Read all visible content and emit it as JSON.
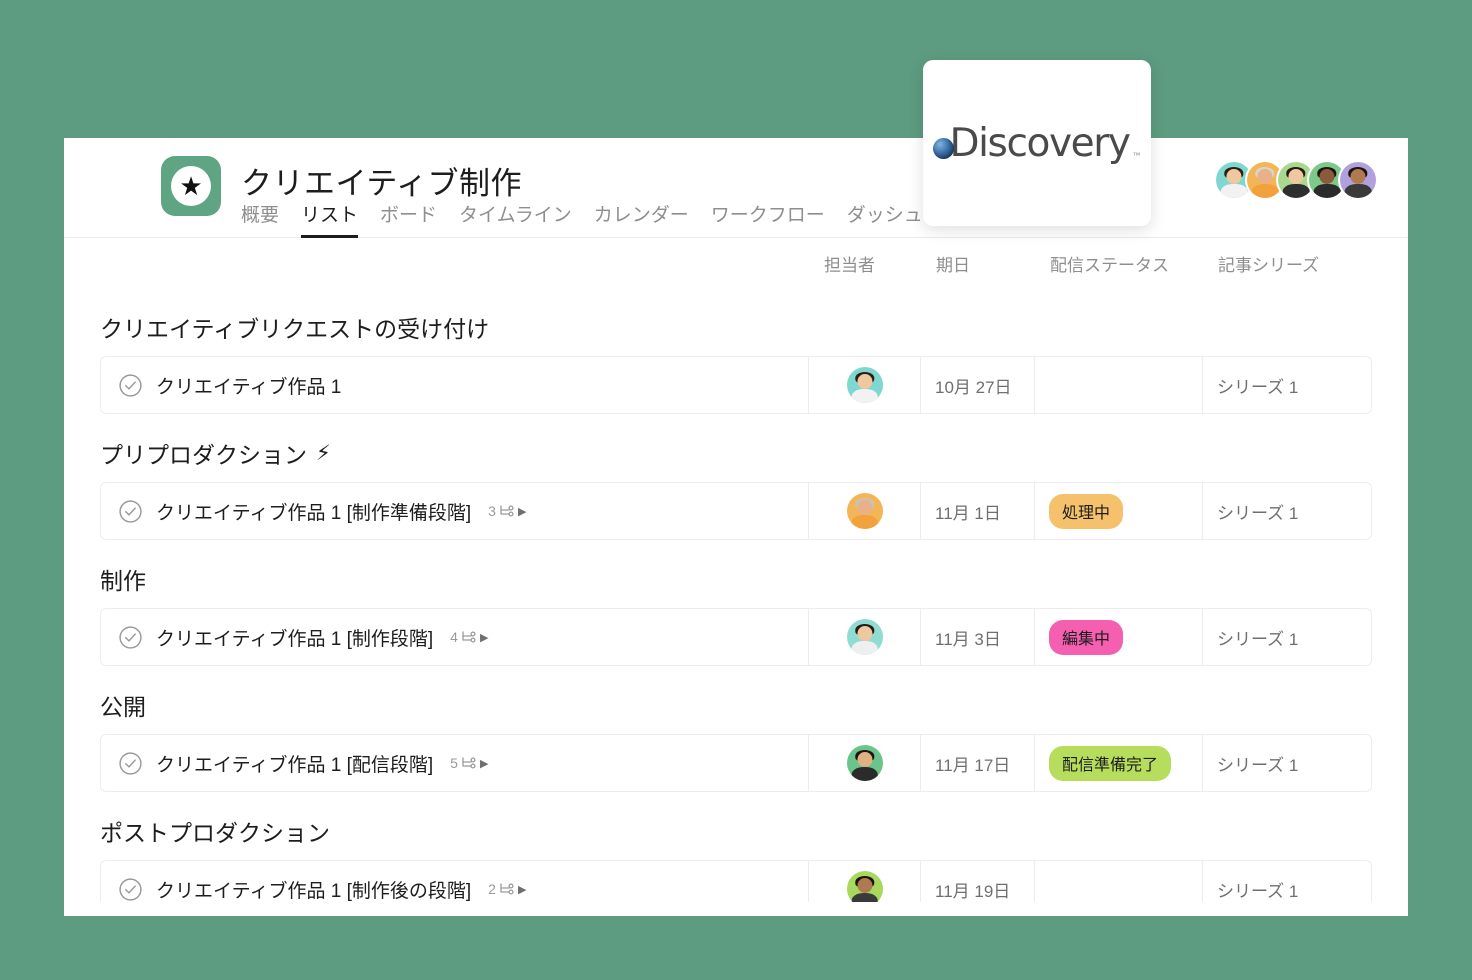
{
  "background_color": "#5d9c80",
  "header": {
    "project_icon": "star-in-circle-icon",
    "project_title": "クリエイティブ制作",
    "tabs": [
      {
        "label": "概要",
        "active": false
      },
      {
        "label": "リスト",
        "active": true
      },
      {
        "label": "ボード",
        "active": false
      },
      {
        "label": "タイムライン",
        "active": false
      },
      {
        "label": "カレンダー",
        "active": false
      },
      {
        "label": "ワークフロー",
        "active": false
      },
      {
        "label": "ダッシュボード",
        "active": false
      }
    ],
    "members": [
      {
        "name": "member-1",
        "bg": "#7fd8d0",
        "skin": "#f0c8a0",
        "hair": "#2b2018",
        "shirt": "#f2f2f2"
      },
      {
        "name": "member-2",
        "bg": "#f4b556",
        "skin": "#e8b189",
        "hair": "#d8d4cc",
        "shirt": "#f2a23c"
      },
      {
        "name": "member-3",
        "bg": "#a9d98e",
        "skin": "#f0c8a0",
        "hair": "#241c16",
        "shirt": "#2e2e2e"
      },
      {
        "name": "member-4",
        "bg": "#7cc98a",
        "skin": "#8a5a3b",
        "hair": "#1c1410",
        "shirt": "#2b2b2b"
      },
      {
        "name": "member-5",
        "bg": "#b2a0dd",
        "skin": "#b07a50",
        "hair": "#1a1410",
        "shirt": "#3a3a3a"
      }
    ]
  },
  "discovery_card": {
    "logo_text": "Discovery",
    "trademark": "™",
    "globe_icon": "globe-icon"
  },
  "columns": {
    "task": "",
    "assignee": "担当者",
    "due_date": "期日",
    "status": "配信ステータス",
    "series": "記事シリーズ"
  },
  "sections": [
    {
      "title": "クリエイティブリクエストの受け付け",
      "emoji": "",
      "tasks": [
        {
          "name": "クリエイティブ作品 1",
          "subtask_count": "",
          "assignee": {
            "name": "avatar-row-1",
            "bg": "#7fd8d0",
            "skin": "#f0c8a0",
            "hair": "#2b2018",
            "shirt": "#f2f2f2"
          },
          "due_date": "10月 27日",
          "status": "",
          "status_bg": "",
          "series": "シリーズ 1"
        }
      ]
    },
    {
      "title": "プリプロダクション",
      "emoji": "⚡",
      "tasks": [
        {
          "name": "クリエイティブ作品 1 [制作準備段階]",
          "subtask_count": "3",
          "assignee": {
            "name": "avatar-row-2",
            "bg": "#f4b556",
            "skin": "#e8b189",
            "hair": "#c9c2b8",
            "shirt": "#f2a23c"
          },
          "due_date": "11月 1日",
          "status": "処理中",
          "status_bg": "#f5c16c",
          "series": "シリーズ 1"
        }
      ]
    },
    {
      "title": "制作",
      "emoji": "",
      "tasks": [
        {
          "name": "クリエイティブ作品 1 [制作段階]",
          "subtask_count": "4",
          "assignee": {
            "name": "avatar-row-3",
            "bg": "#8fdcd2",
            "skin": "#f0c8a0",
            "hair": "#241c16",
            "shirt": "#efefef"
          },
          "due_date": "11月 3日",
          "status": "編集中",
          "status_bg": "#f45fb0",
          "series": "シリーズ 1"
        }
      ]
    },
    {
      "title": "公開",
      "emoji": "",
      "tasks": [
        {
          "name": "クリエイティブ作品 1 [配信段階]",
          "subtask_count": "5",
          "assignee": {
            "name": "avatar-row-4",
            "bg": "#6cc48d",
            "skin": "#e0b183",
            "hair": "#1c1410",
            "shirt": "#2b2b2b"
          },
          "due_date": "11月 17日",
          "status": "配信準備完了",
          "status_bg": "#b7dd5c",
          "series": "シリーズ 1"
        }
      ]
    },
    {
      "title": "ポストプロダクション",
      "emoji": "",
      "tasks": [
        {
          "name": "クリエイティブ作品 1 [制作後の段階]",
          "subtask_count": "2",
          "assignee": {
            "name": "avatar-row-5",
            "bg": "#a8d95e",
            "skin": "#b07a50",
            "hair": "#1a1410",
            "shirt": "#3a3a3a"
          },
          "due_date": "11月 19日",
          "status": "",
          "status_bg": "",
          "series": "シリーズ 1"
        }
      ]
    }
  ]
}
